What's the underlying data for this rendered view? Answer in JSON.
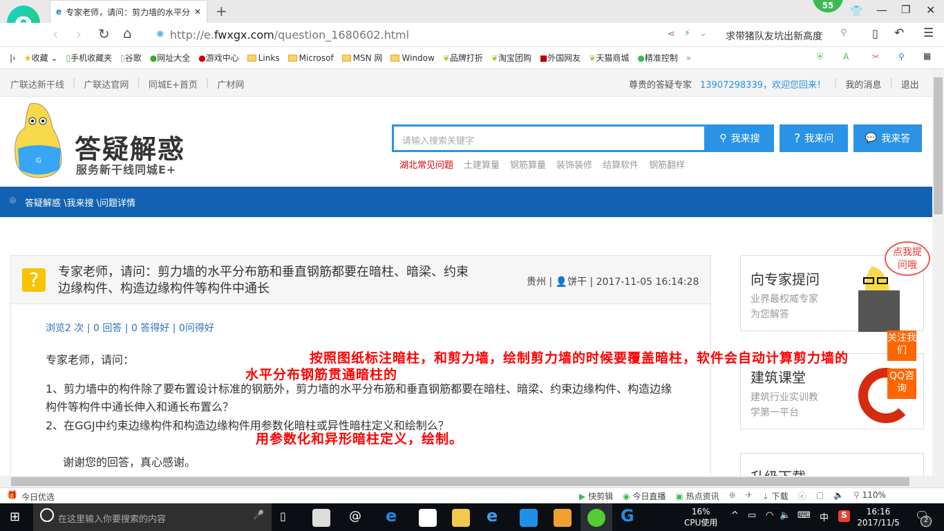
{
  "browser": {
    "tab_title": "专家老师，请问：剪力墙的水平分",
    "url_prefix": "http://e.",
    "url_domain": "fwxgx.com",
    "url_path": "/question_1680602.html",
    "search_hint": "求带猪队友坑出新高度",
    "badge_count": "55",
    "bookmarks": [
      "收藏",
      "手机收藏夹",
      "谷歌",
      "网址大全",
      "游戏中心",
      "Links",
      "Microsof",
      "MSN 网",
      "Window",
      "品牌打折",
      "淘宝团购",
      "外国网友",
      "天猫商城",
      "精准控制"
    ],
    "more": "»"
  },
  "site": {
    "top_links": [
      "广联达新干线",
      "广联达官网",
      "同城E+首页",
      "广材网"
    ],
    "greeting_label": "尊贵的答疑专家",
    "greeting_user": "13907298339，欢迎您回来！",
    "my_messages": "我的消息",
    "logout": "退出",
    "brand": "答疑解惑",
    "slogan": "服务新干线同城E+",
    "search_placeholder": "请输入搜索关键字",
    "btn_search": "我来搜",
    "btn_ask": "我来问",
    "btn_answer": "我来答",
    "hot_tags": [
      "湖北常见问题",
      "土建算量",
      "钢筋算量",
      "装饰装修",
      "结算软件",
      "钢筋翻样"
    ],
    "breadcrumb": "答疑解惑 \\我来搜 \\问题详情"
  },
  "question": {
    "title": "专家老师，请问：剪力墙的水平分布筋和垂直钢筋都要在暗柱、暗梁、约束边缘构件、构造边缘构件等构件中通长",
    "location": "贵州",
    "user": "饼干",
    "datetime": "2017-11-05 16:14:28",
    "stats": "浏览2 次 | 0 回答 | 0 答得好 | 0问得好",
    "greeting": "专家老师，请问：",
    "item1": "1、剪力墙中的构件除了要布置设计标准的钢筋外，剪力墙的水平分布筋和垂直钢筋都要在暗柱、暗梁、约束边缘构件、构造边缘构件等构件中通长伸入和通长布置么？",
    "item2": "2、在GGJ中约束边缘构件和构造边缘构件用参数化暗柱或异性暗柱定义和绘制么？",
    "thanks": "谢谢您的回答，真心感谢。",
    "annotation1": "按照图纸标注暗柱，和剪力墙，绘制剪力墙的时候要覆盖暗柱，软件会自动计算剪力墙的",
    "annotation2": "水平分布钢筋贯通暗柱的",
    "annotation3": "用参数化和异形暗柱定义，绘制。"
  },
  "sidebar": {
    "ask_title": "向专家提问",
    "ask_desc1": "业界最权威专家",
    "ask_desc2": "为您解答",
    "bubble": "点我提问哦",
    "class_title": "建筑课堂",
    "class_desc1": "建筑行业实训教",
    "class_desc2": "学第一平台",
    "follow": "关注我们",
    "qq": "QQ咨询",
    "download_title": "升级下载"
  },
  "statusbar": {
    "left": "今日优选",
    "items": [
      "快剪辑",
      "今日直播",
      "热点资讯"
    ],
    "download": "下载",
    "zoom": "110%"
  },
  "taskbar": {
    "search_placeholder": "在这里输入你要搜索的内容",
    "cpu_percent": "16%",
    "cpu_label": "CPU使用",
    "ime": "中",
    "time": "16:16",
    "date": "2017/11/5",
    "notifications": "2"
  }
}
